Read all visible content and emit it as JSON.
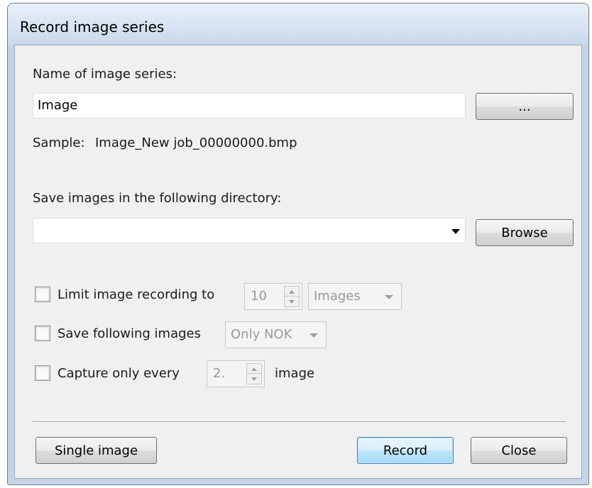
{
  "window": {
    "title": "Record image series"
  },
  "series_name": {
    "label": "Name of image series:",
    "value": "Image",
    "browse_label": "...",
    "sample_prefix": "Sample:",
    "sample_value": "Image_New job_00000000.bmp"
  },
  "directory": {
    "label": "Save images in the following directory:",
    "value": "",
    "browse_label": "Browse"
  },
  "options": {
    "limit": {
      "label": "Limit image recording to",
      "checked": false,
      "count": "10",
      "unit": "Images"
    },
    "save_following": {
      "label": "Save following images",
      "checked": false,
      "mode": "Only NOK"
    },
    "capture_every": {
      "label": "Capture only every",
      "checked": false,
      "interval": "2.",
      "suffix": "image"
    }
  },
  "buttons": {
    "single_image": "Single image",
    "record": "Record",
    "close": "Close"
  }
}
